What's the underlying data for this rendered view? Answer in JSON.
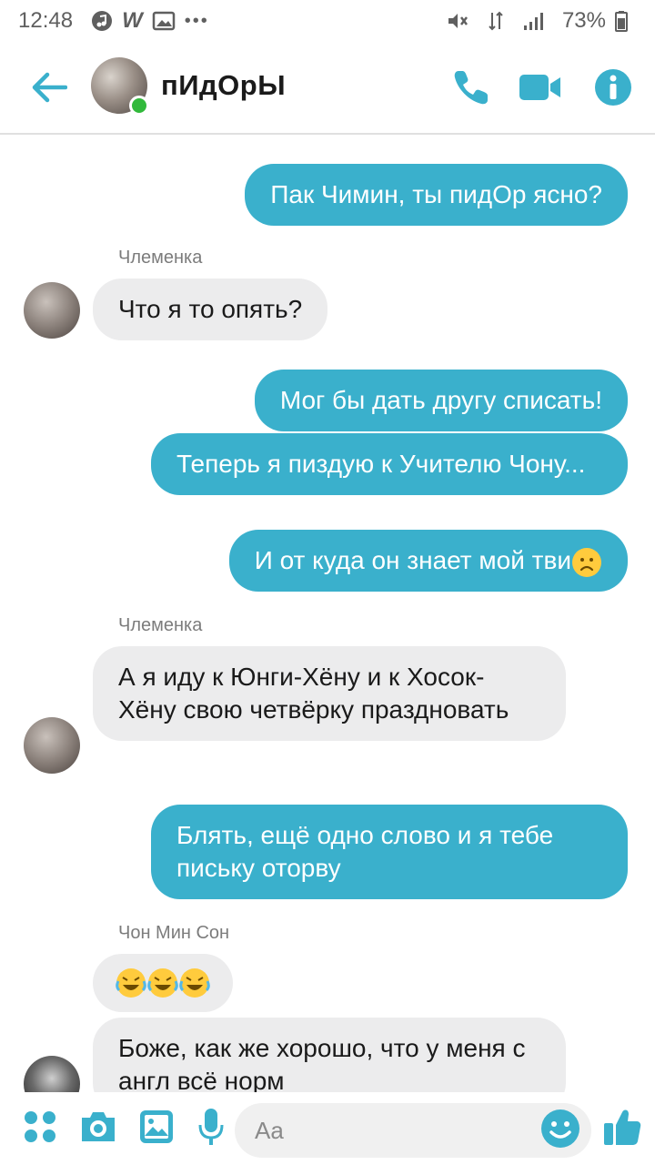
{
  "status_bar": {
    "time": "12:48",
    "battery": "73%",
    "icons": [
      "music-note-icon",
      "wordpress-icon",
      "gallery-icon",
      "more-notifications-icon",
      "mute-icon",
      "data-arrows-icon",
      "signal-icon",
      "battery-icon"
    ]
  },
  "header": {
    "title": "пИдОрЫ",
    "online": true,
    "icons": [
      "back-arrow-icon",
      "phone-icon",
      "video-camera-icon",
      "info-icon"
    ]
  },
  "messages": [
    {
      "direction": "out",
      "text": "Пак Чимин, ты пидОр ясно?"
    },
    {
      "direction": "in",
      "sender": "Члеменка",
      "text": "Что я то опять?"
    },
    {
      "direction": "out",
      "text": "Мог бы дать другу списать!"
    },
    {
      "direction": "out",
      "text": "Теперь я пиздую к Учителю Чону..."
    },
    {
      "direction": "out",
      "text": "И от куда он знает мой тви",
      "emoji": "frowning-face"
    },
    {
      "direction": "in",
      "sender": "Члеменка",
      "text": "А я иду к Юнги-Хёну и к Хосок-Хёну свою четвёрку праздновать"
    },
    {
      "direction": "out",
      "text": "Блять, ещё одно слово и я тебе письку оторву"
    },
    {
      "direction": "in",
      "sender": "Чон Мин Сон",
      "text": "",
      "emoji": "rolling-on-floor-laughing x3"
    },
    {
      "direction": "in",
      "text": "Боже, как же хорошо, что у меня с англ всё норм"
    }
  ],
  "composer": {
    "placeholder": "Aa",
    "icons": [
      "apps-icon",
      "camera-icon",
      "gallery-icon",
      "microphone-icon",
      "emoji-icon",
      "thumbs-up-icon"
    ]
  },
  "colors": {
    "accent": "#3ab0cc",
    "outgoing_bubble": "#3ab0cc",
    "incoming_bubble": "#ececed",
    "online": "#31b93b"
  }
}
